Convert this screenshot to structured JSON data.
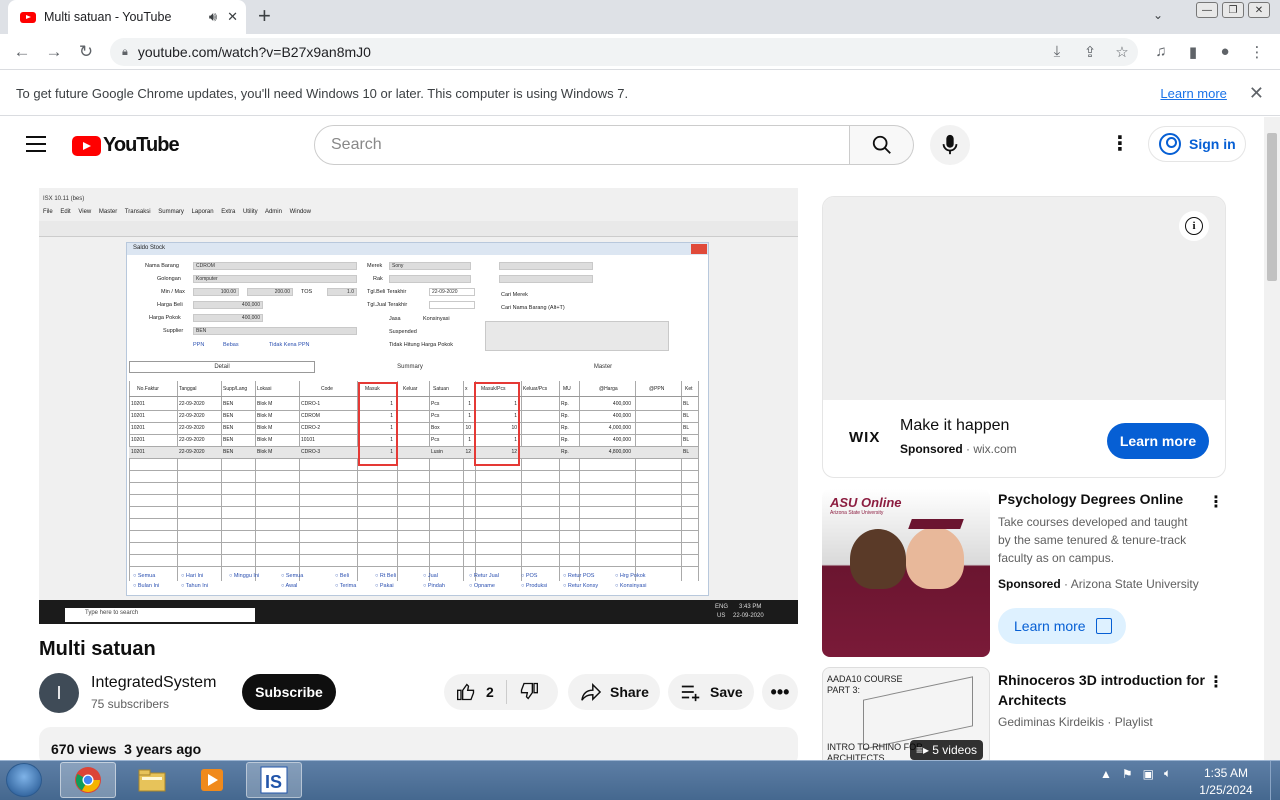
{
  "browser": {
    "tab_title": "Multi satuan - YouTube",
    "url": "youtube.com/watch?v=B27x9an8mJ0",
    "infobar_message": "To get future Google Chrome updates, you'll need Windows 10 or later. This computer is using Windows 7.",
    "infobar_link": "Learn more"
  },
  "youtube": {
    "logo_text": "YouTube",
    "search_placeholder": "Search",
    "signin_label": "Sign in"
  },
  "video_frame": {
    "app_title": "ISX 10.11 (bes)",
    "menu": "File Edit View Master Transaksi Summary Laporan Extra Utility Admin Window",
    "dialog_title": "Saldo Stock",
    "form": {
      "nama_barang_label": "Nama Barang",
      "nama_barang": "CDROM",
      "golongan_label": "Golongan",
      "golongan": "Komputer",
      "minmax_label": "Min / Max",
      "min": "100.00",
      "max": "200.00",
      "tos_label": "TOS",
      "tos": "1.0",
      "harga_beli_label": "Harga Beli",
      "harga_beli": "400,000",
      "harga_pokok_label": "Harga Pokok",
      "harga_pokok": "400,000",
      "supplier_label": "Supplier",
      "supplier": "BEN",
      "merek_label": "Merek",
      "merek": "Sony",
      "rak_label": "Rak",
      "tgl_beli_label": "Tgl.Beli Terakhir",
      "tgl_beli": "22-09-2020",
      "tgl_jual_label": "Tgl.Jual Terakhir",
      "jasa": "Jasa",
      "konsinyasi": "Konsinyasi",
      "suspended": "Suspended",
      "tidak_hitung": "Tidak Hitung Harga Pokok",
      "cari_merek": "Cari Merek",
      "cari_nama": "Cari Nama Barang (Alt+T)",
      "ppn": "PPN",
      "bebas": "Bebas",
      "tidak_kena": "Tidak Kena PPN"
    },
    "tabs": [
      "Detail",
      "Summary",
      "Master"
    ],
    "grid_headers": [
      "No.Faktur",
      "Tanggal",
      "Supp/Lang",
      "Lokasi",
      "Code",
      "Masuk",
      "Keluar",
      "Satuan",
      "x",
      "Masuk/Pcs",
      "Keluar/Pcs",
      "MU",
      "@Harga",
      "@PPN",
      "Ket"
    ],
    "grid_rows": [
      [
        "10201",
        "22-09-2020",
        "BEN",
        "Blok M",
        "CDRO-1",
        "1",
        "",
        "Pcs",
        "1",
        "1",
        "",
        "Rp.",
        "400,000",
        "",
        "BL"
      ],
      [
        "10201",
        "22-09-2020",
        "BEN",
        "Blok M",
        "CDROM",
        "1",
        "",
        "Pcs",
        "1",
        "1",
        "",
        "Rp.",
        "400,000",
        "",
        "BL"
      ],
      [
        "10201",
        "22-09-2020",
        "BEN",
        "Blok M",
        "CDRO-2",
        "1",
        "",
        "Box",
        "10",
        "10",
        "",
        "Rp.",
        "4,000,000",
        "",
        "BL"
      ],
      [
        "10201",
        "22-09-2020",
        "BEN",
        "Blok M",
        "10101",
        "1",
        "",
        "Pcs",
        "1",
        "1",
        "",
        "Rp.",
        "400,000",
        "",
        "BL"
      ],
      [
        "10201",
        "22-09-2020",
        "BEN",
        "Blok M",
        "CDRO-3",
        "1",
        "",
        "Lusin",
        "12",
        "12",
        "",
        "Rp.",
        "4,800,000",
        "",
        "BL"
      ]
    ],
    "radios_row1": [
      "Semua",
      "Hari Ini",
      "Minggu Ini",
      "Semua",
      "Beli",
      "Rt Beli",
      "Jual",
      "Retur Jual",
      "POS",
      "Retur POS",
      "Hrg Pokok"
    ],
    "radios_row2": [
      "Bulan Ini",
      "Tahun Ini",
      "Awal",
      "Terima",
      "Pakai",
      "Pindah",
      "Opname",
      "Produksi",
      "Retur Konsy",
      "Konsinyasi"
    ],
    "taskbar_search": "Type here to search",
    "taskbar_lang": "ENG",
    "taskbar_region": "US",
    "taskbar_time": "3:43 PM",
    "taskbar_date": "22-09-2020"
  },
  "video": {
    "title": "Multi satuan",
    "channel_initial": "I",
    "channel_name": "IntegratedSystem",
    "subscribers": "75 subscribers",
    "subscribe_label": "Subscribe",
    "likes": "2",
    "share_label": "Share",
    "save_label": "Save",
    "views": "670 views",
    "age": "3 years ago"
  },
  "ad": {
    "logo": "WIX",
    "headline": "Make it happen",
    "sponsored": "Sponsored",
    "domain": "wix.com",
    "cta": "Learn more"
  },
  "recommendations": [
    {
      "thumb_logo": "ASU Online",
      "thumb_sub": "Arizona State University",
      "title": "Psychology Degrees Online",
      "desc": "Take courses developed and taught by the same tenured & tenure-track faculty as on campus.",
      "sponsored": "Sponsored",
      "advertiser": "Arizona State University",
      "cta": "Learn more"
    },
    {
      "thumb_text_top": "AADA10 COURSE PART 3:",
      "thumb_text_bottom": "INTRO TO RHINO FOR ARCHITECTS",
      "badge": "5 videos",
      "title": "Rhinoceros 3D introduction for Architects",
      "meta": "Gediminas Kirdeikis · Playlist"
    }
  ],
  "windows": {
    "time": "1:35 AM",
    "date": "1/25/2024"
  },
  "colors": {
    "youtube_red": "#ff0000",
    "link_blue": "#065fd4",
    "chrome_blue": "#1a73e8",
    "highlight_red": "#e53935"
  }
}
